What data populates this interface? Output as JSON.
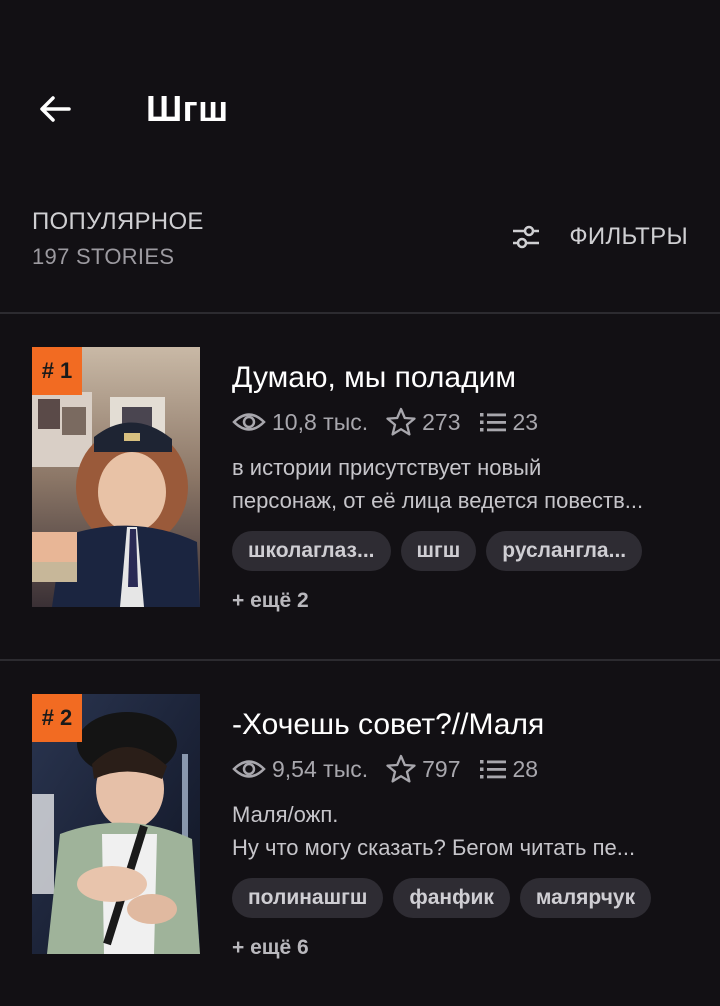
{
  "header": {
    "title": "Шгш"
  },
  "section": {
    "title": "ПОПУЛЯРНОЕ",
    "count": "197 STORIES",
    "filters_label": "ФИЛЬТРЫ"
  },
  "stories": [
    {
      "rank": "# 1",
      "title": "Думаю, мы поладим",
      "reads": "10,8 тыс.",
      "votes": "273",
      "parts": "23",
      "desc_lines": [
        "в истории присутствует новый",
        "персонаж, от её лица ведется повеств..."
      ],
      "tags": [
        "школаглаз...",
        "шгш",
        "русланглa..."
      ],
      "more": "+ ещё 2"
    },
    {
      "rank": "# 2",
      "title": "-Хочешь совет?//Маля",
      "reads": "9,54 тыс.",
      "votes": "797",
      "parts": "28",
      "desc_lines": [
        "Маля/ожп.",
        "Ну что могу сказать? Бегом читать пе..."
      ],
      "tags": [
        "полинашгш",
        "фанфик",
        "малярчук"
      ],
      "more": "+ ещё 6"
    }
  ],
  "colors": {
    "background": "#121014",
    "rank_badge": "#f26b22",
    "tag_bg": "#2e2c33"
  },
  "icons": {
    "back": "arrow-left",
    "filters": "sliders",
    "reads": "eye",
    "votes": "star",
    "parts": "list"
  }
}
